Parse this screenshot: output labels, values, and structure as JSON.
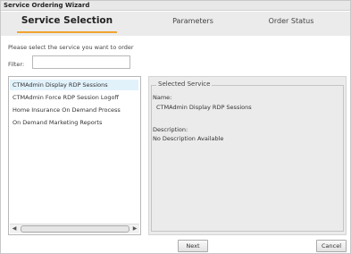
{
  "window": {
    "title": "Service Ordering Wizard"
  },
  "tabs": [
    {
      "label": "Service Selection"
    },
    {
      "label": "Parameters"
    },
    {
      "label": "Order Status"
    }
  ],
  "instructions": "Please select the service you want to order",
  "filter": {
    "label": "Filter:",
    "value": ""
  },
  "services": [
    {
      "label": "CTMAdmin Display RDP Sessions",
      "selected": true
    },
    {
      "label": "CTMAdmin Force RDP Session Logoff",
      "selected": false
    },
    {
      "label": "Home Insurance On Demand Process",
      "selected": false
    },
    {
      "label": "On Demand Marketing Reports",
      "selected": false
    }
  ],
  "selected_service": {
    "legend": "Selected Service",
    "name_label": "Name:",
    "name_value": "CTMAdmin Display RDP Sessions",
    "description_label": "Description:",
    "description_value": "No Description Available"
  },
  "buttons": {
    "next": "Next",
    "cancel": "Cancel"
  },
  "icons": {
    "scroll_left": "scroll-left-arrow-icon",
    "scroll_right": "scroll-right-arrow-icon"
  },
  "colors": {
    "accent": "#f0a430",
    "selection": "#e2f2fb",
    "panel": "#ebebeb"
  }
}
